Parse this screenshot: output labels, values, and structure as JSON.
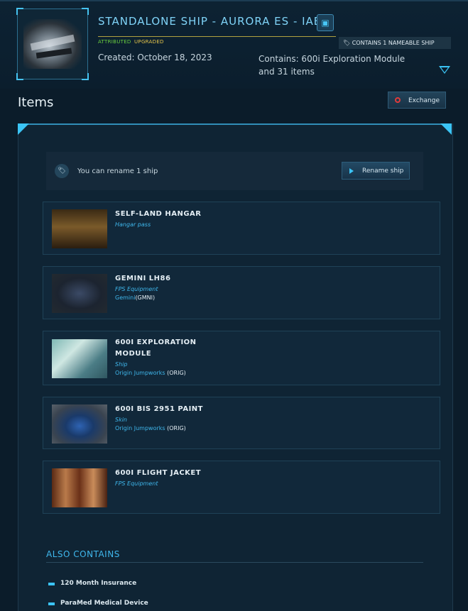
{
  "header": {
    "title": "STANDALONE SHIP - AURORA ES - IAE",
    "badge_attributed": "ATTRIBUTED",
    "badge_upgraded": "UPGRADED",
    "nameable_tag": "CONTAINS 1 NAMEABLE SHIP",
    "created": "Created: October 18, 2023",
    "contains_line1": "Contains: 600i Exploration Module",
    "contains_line2": "and 31 items"
  },
  "section": {
    "title": "Items",
    "exchange_label": "Exchange"
  },
  "rename": {
    "text": "You can rename 1 ship",
    "button_label": "Rename ship"
  },
  "items": [
    {
      "name": "SELF-LAND HANGAR",
      "type": "Hangar pass",
      "manufacturer": "",
      "code": ""
    },
    {
      "name": "GEMINI LH86",
      "type": "FPS Equipment",
      "manufacturer": "Gemini",
      "code": "(GMNI)"
    },
    {
      "name": "600I EXPLORATION MODULE",
      "type": "Ship",
      "manufacturer": "Origin Jumpworks",
      "code": "(ORIG)"
    },
    {
      "name": "600I BIS 2951 PAINT",
      "type": "Skin",
      "manufacturer": "Origin Jumpworks",
      "code": "(ORIG)"
    },
    {
      "name": "600I FLIGHT JACKET",
      "type": "FPS Equipment",
      "manufacturer": "",
      "code": ""
    }
  ],
  "also_contains": {
    "title": "ALSO CONTAINS",
    "items": [
      "120 Month Insurance",
      "ParaMed Medical Device"
    ]
  },
  "colors": {
    "accent": "#3bc4f5",
    "background": "#0b1c2a",
    "attributed": "#6bd13f",
    "upgraded": "#e7c64b",
    "exchange_icon": "#e03b3b"
  }
}
